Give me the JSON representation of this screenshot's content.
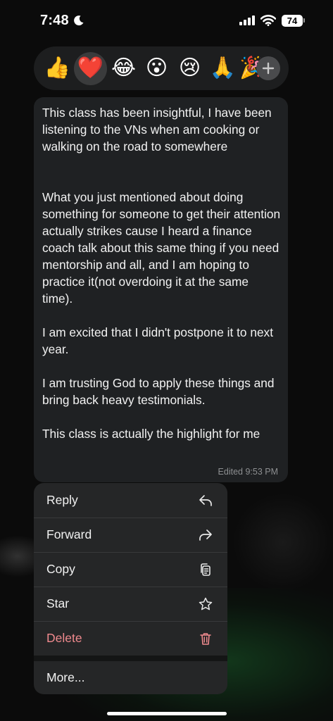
{
  "status_bar": {
    "time": "7:48",
    "battery": "74"
  },
  "reactions": {
    "items": [
      "👍",
      "❤️",
      "😂",
      "😮",
      "😢",
      "🙏",
      "🎉"
    ],
    "selected": "❤️",
    "add_icon": "plus-icon"
  },
  "message": {
    "text": "This class has been insightful, I have been listening to the VNs when am cooking or walking on the road to somewhere\n\n\nWhat you just mentioned about doing something for someone to get their attention actually strikes cause I heard a finance coach talk about this same thing if you need mentorship and all, and I am hoping to practice it(not overdoing it at the same time).\n\nI am excited that I didn't postpone it to next year.\n\nI am trusting God to apply these things and bring back heavy testimonials.\n\nThis class is actually the highlight for me",
    "meta": "Edited 9:53 PM"
  },
  "menu": {
    "reply": "Reply",
    "forward": "Forward",
    "copy": "Copy",
    "star": "Star",
    "delete": "Delete",
    "more": "More...",
    "delete_color": "#f08a8e"
  }
}
